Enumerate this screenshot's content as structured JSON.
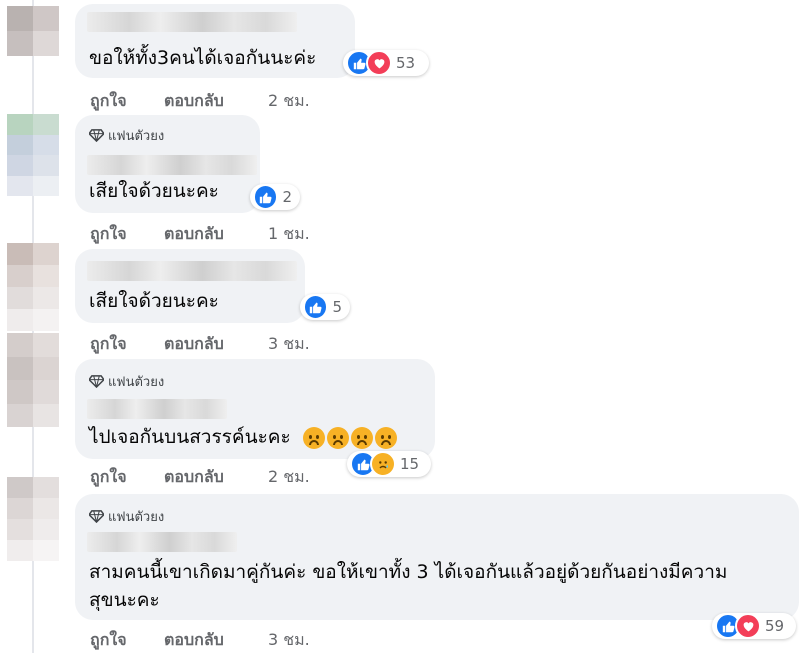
{
  "colors": {
    "bubble_bg": "#f0f2f5",
    "meta_text": "#65676b",
    "like_blue": "#1877f2",
    "love_red": "#f33e58",
    "sad_yellow": "#f7b125"
  },
  "comments": [
    {
      "fan_badge": "",
      "text": "ขอให้ทั้ง3คนได้เจอกันนะค่ะ",
      "reactions": {
        "icons": [
          "like-icon",
          "love-icon"
        ],
        "count": "53"
      },
      "actions": {
        "like": "ถูกใจ",
        "reply": "ตอบกลับ",
        "time": "2 ชม."
      }
    },
    {
      "fan_badge": "แฟนตัวยง",
      "text": "เสียใจด้วยนะคะ",
      "reactions": {
        "icons": [
          "like-icon"
        ],
        "count": "2"
      },
      "actions": {
        "like": "ถูกใจ",
        "reply": "ตอบกลับ",
        "time": "1 ชม."
      }
    },
    {
      "fan_badge": "",
      "text": "เสียใจด้วยนะคะ",
      "reactions": {
        "icons": [
          "like-icon"
        ],
        "count": "5"
      },
      "actions": {
        "like": "ถูกใจ",
        "reply": "ตอบกลับ",
        "time": "3 ชม."
      }
    },
    {
      "fan_badge": "แฟนตัวยง",
      "text": "ไปเจอกันบนสวรรค์นะคะ",
      "emojis": [
        "sad-face-emoji",
        "sad-face-emoji",
        "sad-face-emoji",
        "sad-face-emoji"
      ],
      "reactions": {
        "icons": [
          "like-icon",
          "sad-icon"
        ],
        "count": "15"
      },
      "actions": {
        "like": "ถูกใจ",
        "reply": "ตอบกลับ",
        "time": "2 ชม."
      }
    },
    {
      "fan_badge": "แฟนตัวยง",
      "text_line1": "สามคนนี้เขาเกิดมาคู่กันค่ะ ขอให้เขาทั้ง 3 ได้เจอกันแล้วอยู่ด้วยกันอย่างมีความ",
      "text_line2": "สุขนะคะ",
      "reactions": {
        "icons": [
          "like-icon",
          "love-icon"
        ],
        "count": "59"
      },
      "actions": {
        "like": "ถูกใจ",
        "reply": "ตอบกลับ",
        "time": "3 ชม."
      }
    }
  ]
}
